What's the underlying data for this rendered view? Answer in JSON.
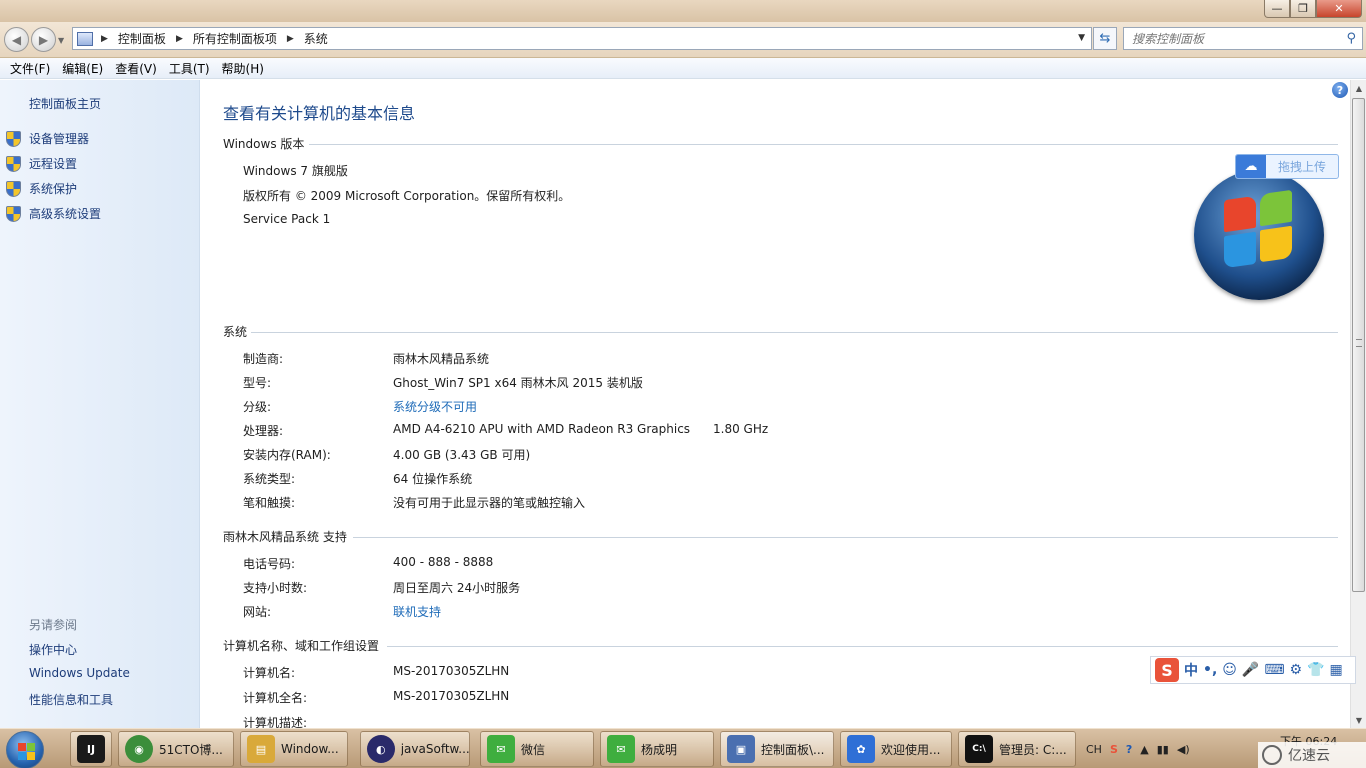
{
  "titlebar": {
    "min": "—",
    "max": "❐",
    "close": "✕"
  },
  "nav": {
    "back": "◀",
    "forward": "▶",
    "breadcrumbs": [
      "控制面板",
      "所有控制面板项",
      "系统"
    ],
    "search_placeholder": "搜索控制面板"
  },
  "menu": [
    "文件(F)",
    "编辑(E)",
    "查看(V)",
    "工具(T)",
    "帮助(H)"
  ],
  "left": {
    "home": "控制面板主页",
    "tasks": [
      "设备管理器",
      "远程设置",
      "系统保护",
      "高级系统设置"
    ],
    "see_also_title": "另请参阅",
    "see_also": [
      "操作中心",
      "Windows Update",
      "性能信息和工具"
    ]
  },
  "main": {
    "title": "查看有关计算机的基本信息",
    "edition": {
      "heading": "Windows 版本",
      "name": "Windows 7 旗舰版",
      "copyright": "版权所有 © 2009 Microsoft Corporation。保留所有权利。",
      "sp": "Service Pack 1"
    },
    "system": {
      "heading": "系统",
      "rows": [
        {
          "label": "制造商:",
          "value": "雨林木风精品系统"
        },
        {
          "label": "型号:",
          "value": "Ghost_Win7 SP1 x64 雨林木风 2015 装机版"
        },
        {
          "label": "分级:",
          "value": "系统分级不可用"
        },
        {
          "label": "处理器:",
          "value": "AMD A4-6210 APU with AMD Radeon R3 Graphics",
          "extra": "1.80 GHz"
        },
        {
          "label": "安装内存(RAM):",
          "value": "4.00 GB (3.43 GB 可用)"
        },
        {
          "label": "系统类型:",
          "value": "64 位操作系统"
        },
        {
          "label": "笔和触摸:",
          "value": "没有可用于此显示器的笔或触控输入"
        }
      ]
    },
    "support": {
      "heading": "雨林木风精品系统 支持",
      "rows": [
        {
          "label": "电话号码:",
          "value": "400 - 888 - 8888"
        },
        {
          "label": "支持小时数:",
          "value": "周日至周六  24小时服务"
        },
        {
          "label": "网站:",
          "value": "联机支持"
        }
      ]
    },
    "computer": {
      "heading": "计算机名称、域和工作组设置",
      "rows": [
        {
          "label": "计算机名:",
          "value": "MS-20170305ZLHN"
        },
        {
          "label": "计算机全名:",
          "value": "MS-20170305ZLHN"
        },
        {
          "label": "计算机描述:",
          "value": ""
        }
      ]
    },
    "upload_label": "拖拽上传",
    "help": "?"
  },
  "ime": {
    "logo": "S",
    "items": [
      "中",
      "•,",
      "☺",
      "🎤",
      "⌨",
      "⚙",
      "👕",
      "▦"
    ]
  },
  "taskbar": {
    "buttons": [
      {
        "label": "",
        "icon": "IJ",
        "color": "#1a1a1a"
      },
      {
        "label": "51CTO博...",
        "icon": "◉",
        "color": "#3b8e3b"
      },
      {
        "label": "Window...",
        "icon": "▤",
        "color": "#d9a93a"
      },
      {
        "label": "javaSoftw...",
        "icon": "◐",
        "color": "#2a2a6a"
      },
      {
        "label": "微信",
        "icon": "✉",
        "color": "#3fae3f"
      },
      {
        "label": "杨成明",
        "icon": "✉",
        "color": "#3fae3f"
      },
      {
        "label": "控制面板\\...",
        "icon": "▣",
        "color": "#4a6fb0"
      },
      {
        "label": "欢迎使用...",
        "icon": "✿",
        "color": "#2f6fd6"
      },
      {
        "label": "管理员: C:...",
        "icon": "C:\\",
        "color": "#111111"
      }
    ],
    "tray": [
      "CH",
      "S",
      "?"
    ],
    "clock": "下午 06:24",
    "watermark": "亿速云"
  }
}
